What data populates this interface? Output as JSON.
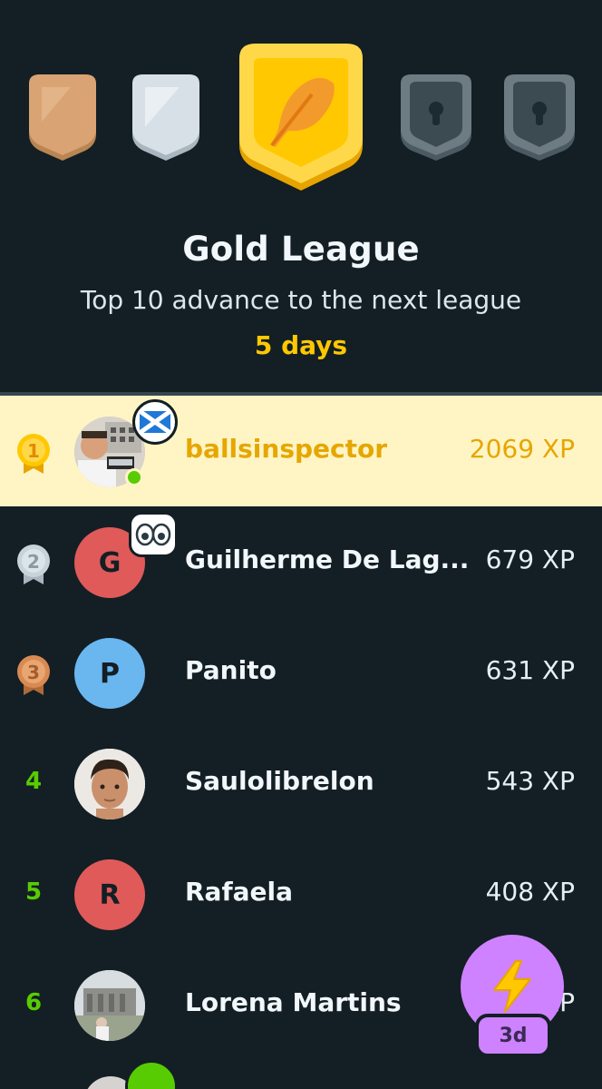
{
  "league": {
    "title": "Gold League",
    "subtitle": "Top 10 advance to the next league",
    "days_left": "5 days",
    "badges": [
      "bronze-badge",
      "silver-badge",
      "gold-badge-current",
      "locked-badge",
      "locked-badge"
    ]
  },
  "colors": {
    "background": "#131f24",
    "gold_text": "#ffc800",
    "highlight_row": "#fff5c4",
    "rank_green": "#58cc02",
    "boost_purple": "#ce82ff"
  },
  "leaderboard": [
    {
      "rank": "1",
      "name": "ballsinspector",
      "xp": "2069 XP",
      "avatar": "photo",
      "flair": "scotland-flag",
      "current_user": true
    },
    {
      "rank": "2",
      "name": "Guilherme De Lag...",
      "xp": "679 XP",
      "avatar_letter": "G",
      "avatar_color": "#e05a5a",
      "flair": "eyes"
    },
    {
      "rank": "3",
      "name": "Panito",
      "xp": "631 XP",
      "avatar_letter": "P",
      "avatar_color": "#6ab7f0"
    },
    {
      "rank": "4",
      "name": "Saulolibrelon",
      "xp": "543 XP",
      "avatar": "photo"
    },
    {
      "rank": "5",
      "name": "Rafaela",
      "xp": "408 XP",
      "avatar_letter": "R",
      "avatar_color": "#e05a5a"
    },
    {
      "rank": "6",
      "name": "Lorena Martins",
      "xp": "XP",
      "avatar": "photo"
    }
  ],
  "boost": {
    "label": "3d",
    "icon": "lightning-icon"
  }
}
